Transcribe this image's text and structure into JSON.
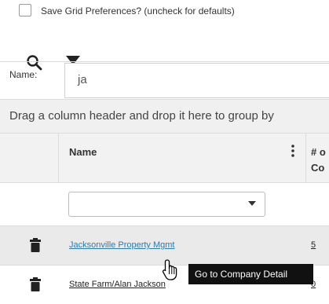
{
  "preferences": {
    "save_label": "Save Grid Preferences? (uncheck for defaults)",
    "checked": false
  },
  "toolbar": {
    "search_icon": "search-icon",
    "clear_filter_icon": "filter-clear-icon"
  },
  "name_filter": {
    "label": "Name:",
    "value": "ja"
  },
  "group_panel": {
    "text": "Drag a column header and drop it here to group by"
  },
  "grid": {
    "columns": [
      {
        "label": "Name"
      },
      {
        "label_line1": "# o",
        "label_line2": "Co"
      }
    ],
    "rows": [
      {
        "name": "Jacksonville Property Mgmt",
        "count": "5"
      },
      {
        "name": "State Farm/Alan Jackson",
        "count": "0"
      }
    ]
  },
  "tooltip": {
    "text": "Go to Company Detail"
  },
  "colors": {
    "link": "#2f7ba8",
    "header_bg": "#f2f2f2",
    "row_hover": "#eaeaea"
  }
}
